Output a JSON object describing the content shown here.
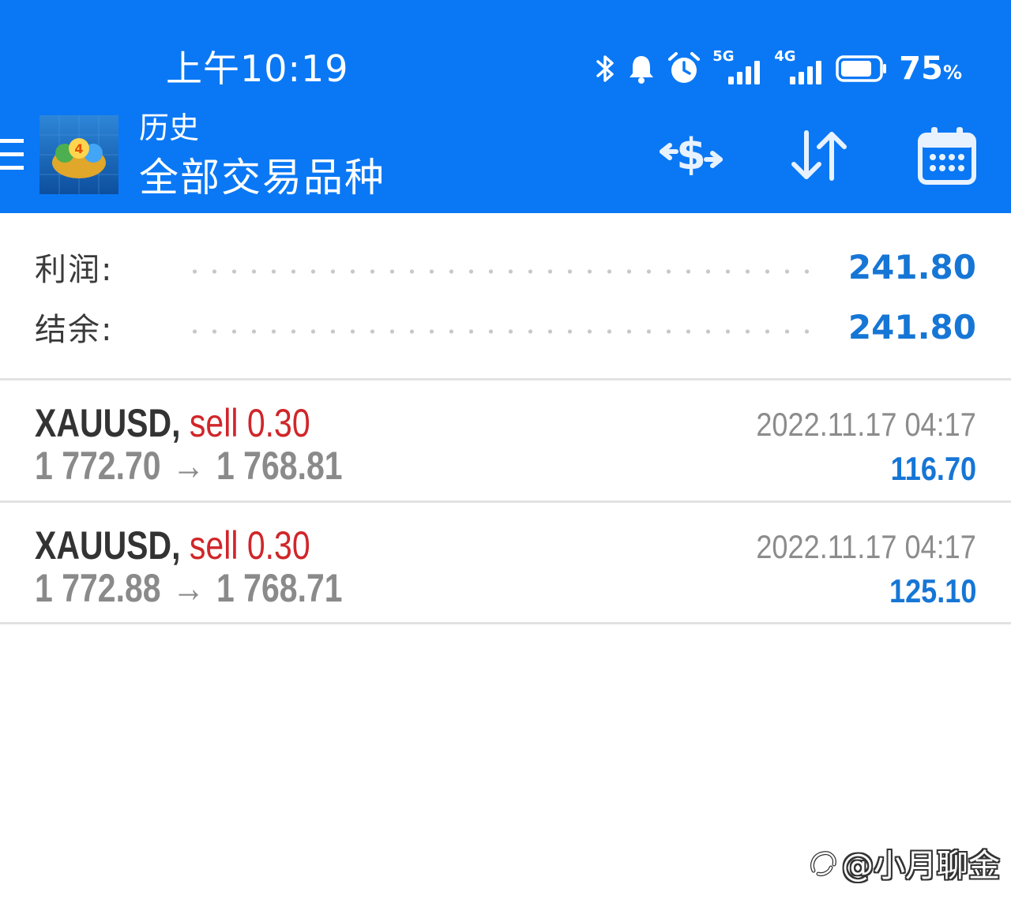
{
  "status_bar": {
    "time": "上午10:19",
    "icons": [
      "bluetooth-icon",
      "bell-icon",
      "alarm-icon",
      "signal-5g-icon",
      "signal-4g-icon",
      "battery-icon"
    ],
    "net1": "5G",
    "net2": "4G",
    "battery_value": "75",
    "battery_unit": "%"
  },
  "toolbar": {
    "title_small": "历史",
    "title_large": "全部交易品种",
    "actions": [
      "currency-exchange-icon",
      "sort-icon",
      "calendar-icon"
    ]
  },
  "summary": {
    "profit_label": "利润:",
    "profit_value": "241.80",
    "balance_label": "结余:",
    "balance_value": "241.80"
  },
  "trades": [
    {
      "symbol": "XAUUSD,",
      "side": "sell",
      "volume": "0.30",
      "open_price": "1 772.70",
      "arrow": "→",
      "close_price": "1 768.81",
      "time": "2022.11.17 04:17",
      "profit": "116.70"
    },
    {
      "symbol": "XAUUSD,",
      "side": "sell",
      "volume": "0.30",
      "open_price": "1 772.88",
      "arrow": "→",
      "close_price": "1 768.71",
      "time": "2022.11.17 04:17",
      "profit": "125.10"
    }
  ],
  "watermark": {
    "text": "@小月聊金"
  },
  "colors": {
    "header_blue": "#0a78f5",
    "value_blue": "#1676d6",
    "sell_red": "#d0262a",
    "text_gray": "#8a8a8a"
  }
}
